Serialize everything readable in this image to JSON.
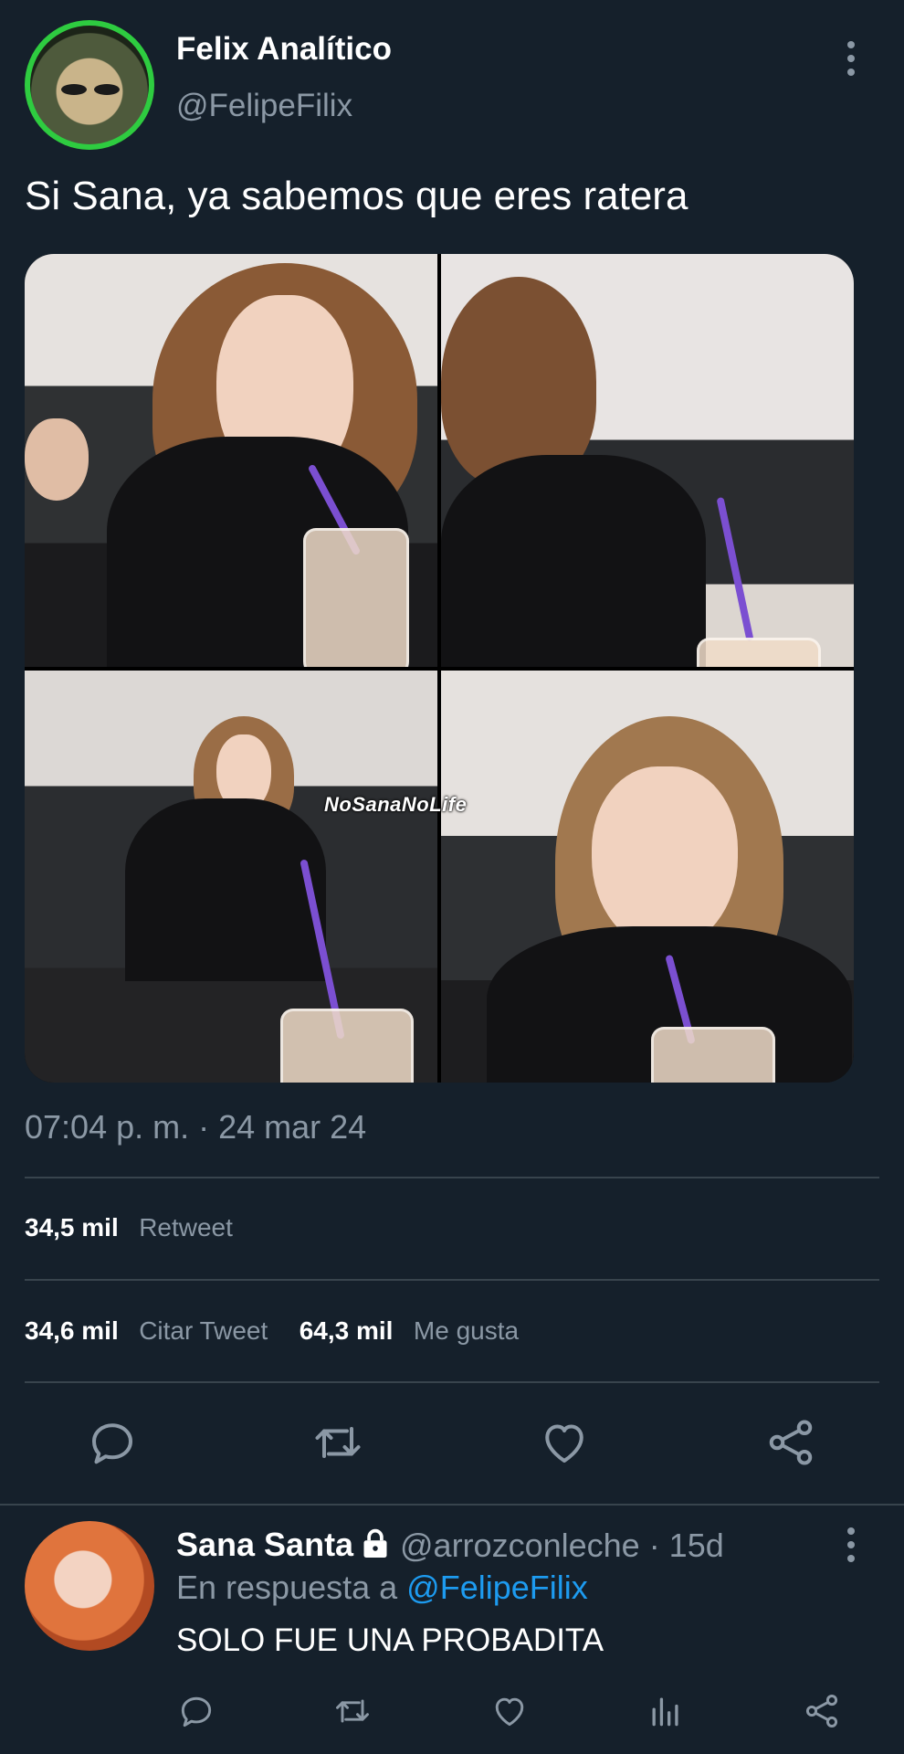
{
  "tweet": {
    "author_name": "Felix Analítico",
    "author_handle": "@FelipeFilix",
    "text": "Si Sana, ya sabemos que eres ratera",
    "media_watermark": "NoSanaNoLife",
    "timestamp": "07:04 p. m. · 24 mar 24",
    "stats": {
      "retweets_count": "34,5 mil",
      "retweets_label": "Retweet",
      "quotes_count": "34,6 mil",
      "quotes_label": "Citar Tweet",
      "likes_count": "64,3 mil",
      "likes_label": "Me gusta"
    },
    "icons": [
      "reply-icon",
      "retweet-icon",
      "like-icon",
      "share-icon"
    ]
  },
  "reply": {
    "author_name": "Sana Santa",
    "author_handle": "@arrozconleche",
    "time": "· 15d",
    "reply_prefix": "En respuesta a",
    "reply_mention": "@FelipeFilix",
    "text": "SOLO FUE UNA PROBADITA",
    "icons": [
      "reply-icon",
      "retweet-icon",
      "like-icon",
      "analytics-icon",
      "share-icon"
    ]
  },
  "colors": {
    "background": "#15202b",
    "secondary_text": "#8b98a5",
    "link": "#1d9bf0",
    "divider": "#38444d"
  }
}
